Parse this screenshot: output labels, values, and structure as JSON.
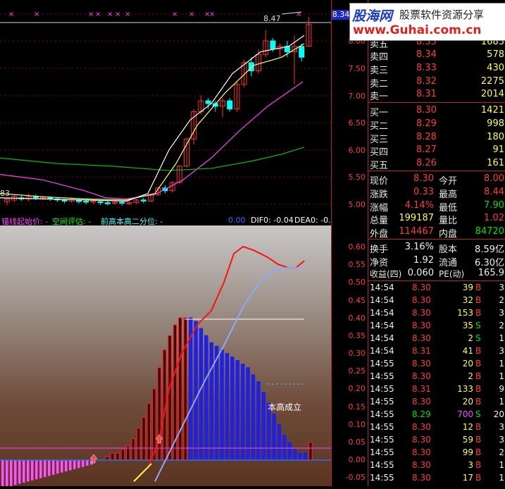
{
  "watermark": {
    "brand_cn": "股海网",
    "slogan": "股票软件资源分享",
    "url": "www.Guhai.com.cn"
  },
  "price_chart": {
    "last_price_tag": "8.34",
    "high_marker": "8.47",
    "low_marker": "83",
    "axis_labels": [
      "8.00",
      "7.50",
      "7.00",
      "6.50",
      "6.00",
      "5.50",
      "5.00"
    ],
    "colors": {
      "up": "#ff3030",
      "down": "#00ffff",
      "ma5": "#ffffff",
      "ma10": "#ffff60",
      "ma20": "#ff40ff",
      "ma60": "#00ff00"
    }
  },
  "indicator": {
    "legend": [
      {
        "text": "锚线起始价: -",
        "color": "#ff40ff"
      },
      {
        "text": "空间评估: -",
        "color": "#00ff00"
      },
      {
        "text": "前高本高二分位: -",
        "color": "#40ffff"
      },
      {
        "text": "0.00",
        "color": "#2f6bff"
      },
      {
        "text": "DIF0: -0.04",
        "color": "#ffffff"
      },
      {
        "text": "DEA0: -0.",
        "color": "#ffffff"
      }
    ],
    "annotation": "本高成立",
    "axis_labels": [
      "0.60",
      "0.55",
      "0.50",
      "0.45",
      "0.40",
      "0.35",
      "0.30",
      "0.25",
      "0.20",
      "0.15",
      "0.10",
      "0.05",
      "0.00",
      "-0.05"
    ]
  },
  "quote": {
    "sell": [
      {
        "label": "卖五",
        "price": "8.35",
        "vol": "1683"
      },
      {
        "label": "卖四",
        "price": "8.34",
        "vol": "578"
      },
      {
        "label": "卖三",
        "price": "8.33",
        "vol": "430"
      },
      {
        "label": "卖二",
        "price": "8.32",
        "vol": "2275"
      },
      {
        "label": "卖一",
        "price": "8.31",
        "vol": "2014"
      }
    ],
    "buy": [
      {
        "label": "买一",
        "price": "8.30",
        "vol": "1421"
      },
      {
        "label": "买二",
        "price": "8.29",
        "vol": "998"
      },
      {
        "label": "买三",
        "price": "8.28",
        "vol": "180"
      },
      {
        "label": "买四",
        "price": "8.27",
        "vol": "91"
      },
      {
        "label": "买五",
        "price": "8.26",
        "vol": "161"
      }
    ],
    "stats": [
      {
        "l1": "现价",
        "v1": "8.30",
        "c1": "red",
        "l2": "今开",
        "v2": "8.00",
        "c2": "red"
      },
      {
        "l1": "涨跌",
        "v1": "0.33",
        "c1": "red",
        "l2": "最高",
        "v2": "8.44",
        "c2": "red"
      },
      {
        "l1": "涨幅",
        "v1": "4.14%",
        "c1": "red",
        "l2": "最低",
        "v2": "7.90",
        "c2": "green"
      },
      {
        "l1": "总量",
        "v1": "199187",
        "c1": "yellow",
        "l2": "量比",
        "v2": "1.02",
        "c2": "red"
      },
      {
        "l1": "外盘",
        "v1": "114467",
        "c1": "red",
        "l2": "内盘",
        "v2": "84720",
        "c2": "green"
      }
    ],
    "stats2": [
      {
        "l1": "换手",
        "v1": "3.16%",
        "l2": "股本",
        "v2": "8.59亿"
      },
      {
        "l1": "净资",
        "v1": "1.92",
        "l2": "流通",
        "v2": "6.30亿"
      },
      {
        "l1": "收益(四)",
        "v1": "0.060",
        "l2": "PE(动)",
        "v2": "165.9"
      }
    ],
    "ticks": [
      {
        "t": "14:54",
        "p": "8.30",
        "v": "39",
        "d": "B",
        "n": "3"
      },
      {
        "t": "14:54",
        "p": "8.30",
        "v": "32",
        "d": "B",
        "n": "2"
      },
      {
        "t": "14:54",
        "p": "8.30",
        "v": "153",
        "d": "B",
        "n": "3"
      },
      {
        "t": "14:54",
        "p": "8.30",
        "v": "35",
        "d": "S",
        "n": "2"
      },
      {
        "t": "14:54",
        "p": "8.30",
        "v": "2",
        "d": "S",
        "n": "1"
      },
      {
        "t": "14:54",
        "p": "8.31",
        "v": "41",
        "d": "B",
        "n": "3"
      },
      {
        "t": "14:55",
        "p": "8.30",
        "v": "20",
        "d": "B",
        "n": "1"
      },
      {
        "t": "14:55",
        "p": "8.30",
        "v": "2",
        "d": "B",
        "n": "1"
      },
      {
        "t": "14:55",
        "p": "8.31",
        "v": "133",
        "d": "B",
        "n": "9"
      },
      {
        "t": "14:55",
        "p": "8.30",
        "v": "20",
        "d": "B",
        "n": "1"
      },
      {
        "t": "14:55",
        "p": "8.29",
        "v": "700",
        "d": "S",
        "n": "20"
      },
      {
        "t": "14:55",
        "p": "8.30",
        "v": "12",
        "d": "B",
        "n": "3"
      },
      {
        "t": "14:55",
        "p": "8.30",
        "v": "59",
        "d": "B",
        "n": "3"
      },
      {
        "t": "14:55",
        "p": "8.30",
        "v": "99",
        "d": "B",
        "n": "2"
      },
      {
        "t": "14:55",
        "p": "8.30",
        "v": "3",
        "d": "B",
        "n": "1"
      },
      {
        "t": "14:55",
        "p": "8.30",
        "v": "17",
        "d": "B",
        "n": "1"
      }
    ]
  }
}
